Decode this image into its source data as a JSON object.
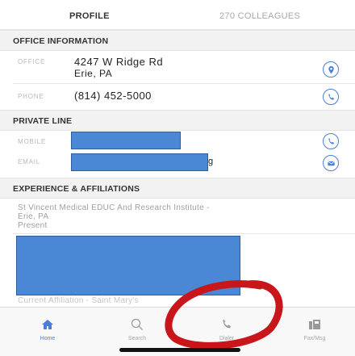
{
  "tabs": {
    "profile": "PROFILE",
    "colleagues": "270 COLLEAGUES"
  },
  "office_info": {
    "heading": "OFFICE INFORMATION",
    "office_label": "OFFICE",
    "address_line1": "4247 W Ridge Rd",
    "address_line2": "Erie, PA",
    "phone_label": "PHONE",
    "phone": "(814) 452-5000"
  },
  "private_line": {
    "heading": "PRIVATE LINE",
    "mobile_label": "MOBILE",
    "email_label": "EMAIL",
    "email_tail": "g"
  },
  "experience": {
    "heading": "EXPERIENCE & AFFILIATIONS",
    "affiliation_line1": "St Vincent Medical EDUC And Research Institute -",
    "affiliation_line2": "Erie, PA",
    "affiliation_line3": "Present",
    "cut_text": "Current Affiliation - Saint Mary's"
  },
  "nav": {
    "home": "Home",
    "search": "Search",
    "dialer": "Dialer",
    "faxmsg": "Fax/Msg"
  },
  "colors": {
    "accent": "#4a7fd6",
    "redaction": "#4a87d4",
    "annotation": "#c8161b"
  }
}
